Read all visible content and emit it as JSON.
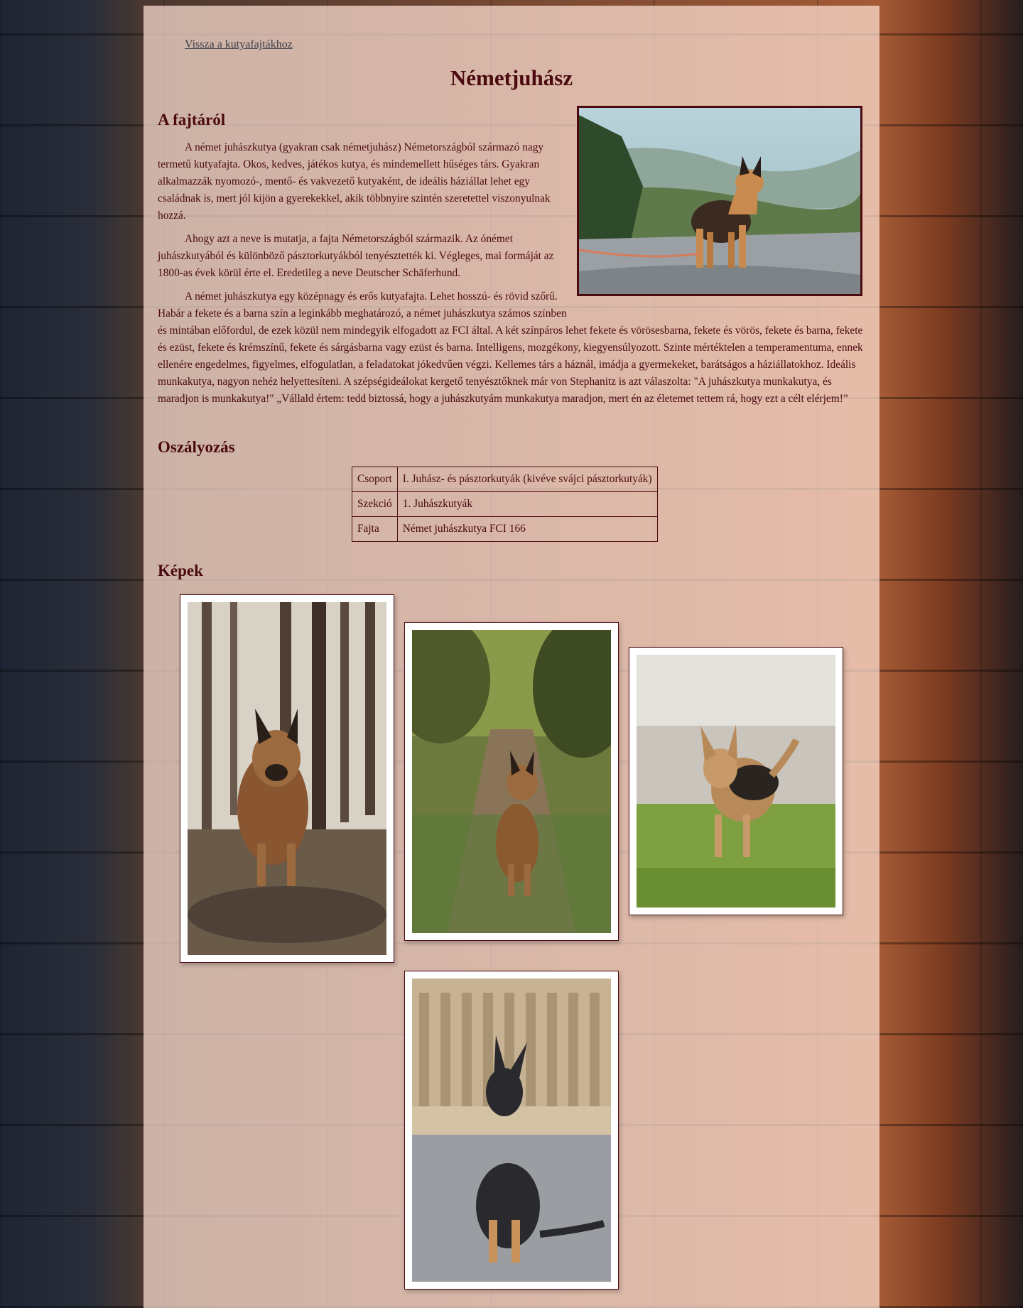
{
  "nav": {
    "back_label": "Vissza a kutyafajtákhoz"
  },
  "page": {
    "title": "Németjuhász"
  },
  "about": {
    "heading": "A fajtáról",
    "paragraphs": [
      "A német juhászkutya (gyakran csak németjuhász) Németországból származó nagy termetű kutyafajta. Okos, kedves, játékos kutya, és mindemellett hűséges társ. Gyakran alkalmazzák nyomozó-, mentő- és vakvezető kutyaként, de ideális háziállat lehet egy családnak is, mert jól kijön a gyerekekkel, akik többnyire szintén szeretettel viszonyulnak hozzá.",
      "Ahogy azt a neve is mutatja, a fajta Németországból származik. Az ónémet juhászkutyából és különböző pásztorkutyákból tenyésztették ki. Végleges, mai formáját az 1800-as évek körül érte el. Eredetileg a neve Deutscher Schäferhund.",
      "A német juhászkutya egy középnagy és erős kutyafajta. Lehet hosszú- és rövid szőrű. Habár a fekete és a barna szín a leginkább meghatározó, a német juhászkutya számos színben és mintában előfordul, de ezek közül nem mindegyik elfogadott az FCI által. A két színpáros lehet fekete és vörösesbarna, fekete és vörös, fekete és barna, fekete és ezüst, fekete és krémszínű, fekete és sárgásbarna vagy ezüst és barna. Intelligens, mozgékony, kiegyensúlyozott. Szinte mértéktelen a temperamentuma, ennek ellenére engedelmes, figyelmes, elfogulatlan, a feladatokat jókedvűen végzi. Kellemes társ a háznál, imádja a gyermekeket, barátságos a háziállatokhoz. Ideális munkakutya, nagyon nehéz helyettesíteni. A szépségideálokat kergető tenyésztőknek már von Stephanitz is azt válaszolta: \"A juhászkutya munkakutya, és maradjon is munkakutya!\" „Vállald értem: tedd biztossá, hogy a juhászkutyám munkakutya maradjon, mert én az életemet tettem rá, hogy ezt a célt elérjem!”"
    ]
  },
  "classification": {
    "heading": "Oszályozás",
    "rows": [
      {
        "key": "Csoport",
        "value": "I. Juhász- és pásztorkutyák (kivéve svájci pásztorkutyák)"
      },
      {
        "key": "Szekció",
        "value": "1. Juhászkutyák"
      },
      {
        "key": "Fajta",
        "value": "Német juhászkutya FCI 166"
      }
    ]
  },
  "gallery": {
    "heading": "Képek"
  },
  "colors": {
    "accent": "#4a0a10",
    "panel": "#ffe2d6"
  }
}
